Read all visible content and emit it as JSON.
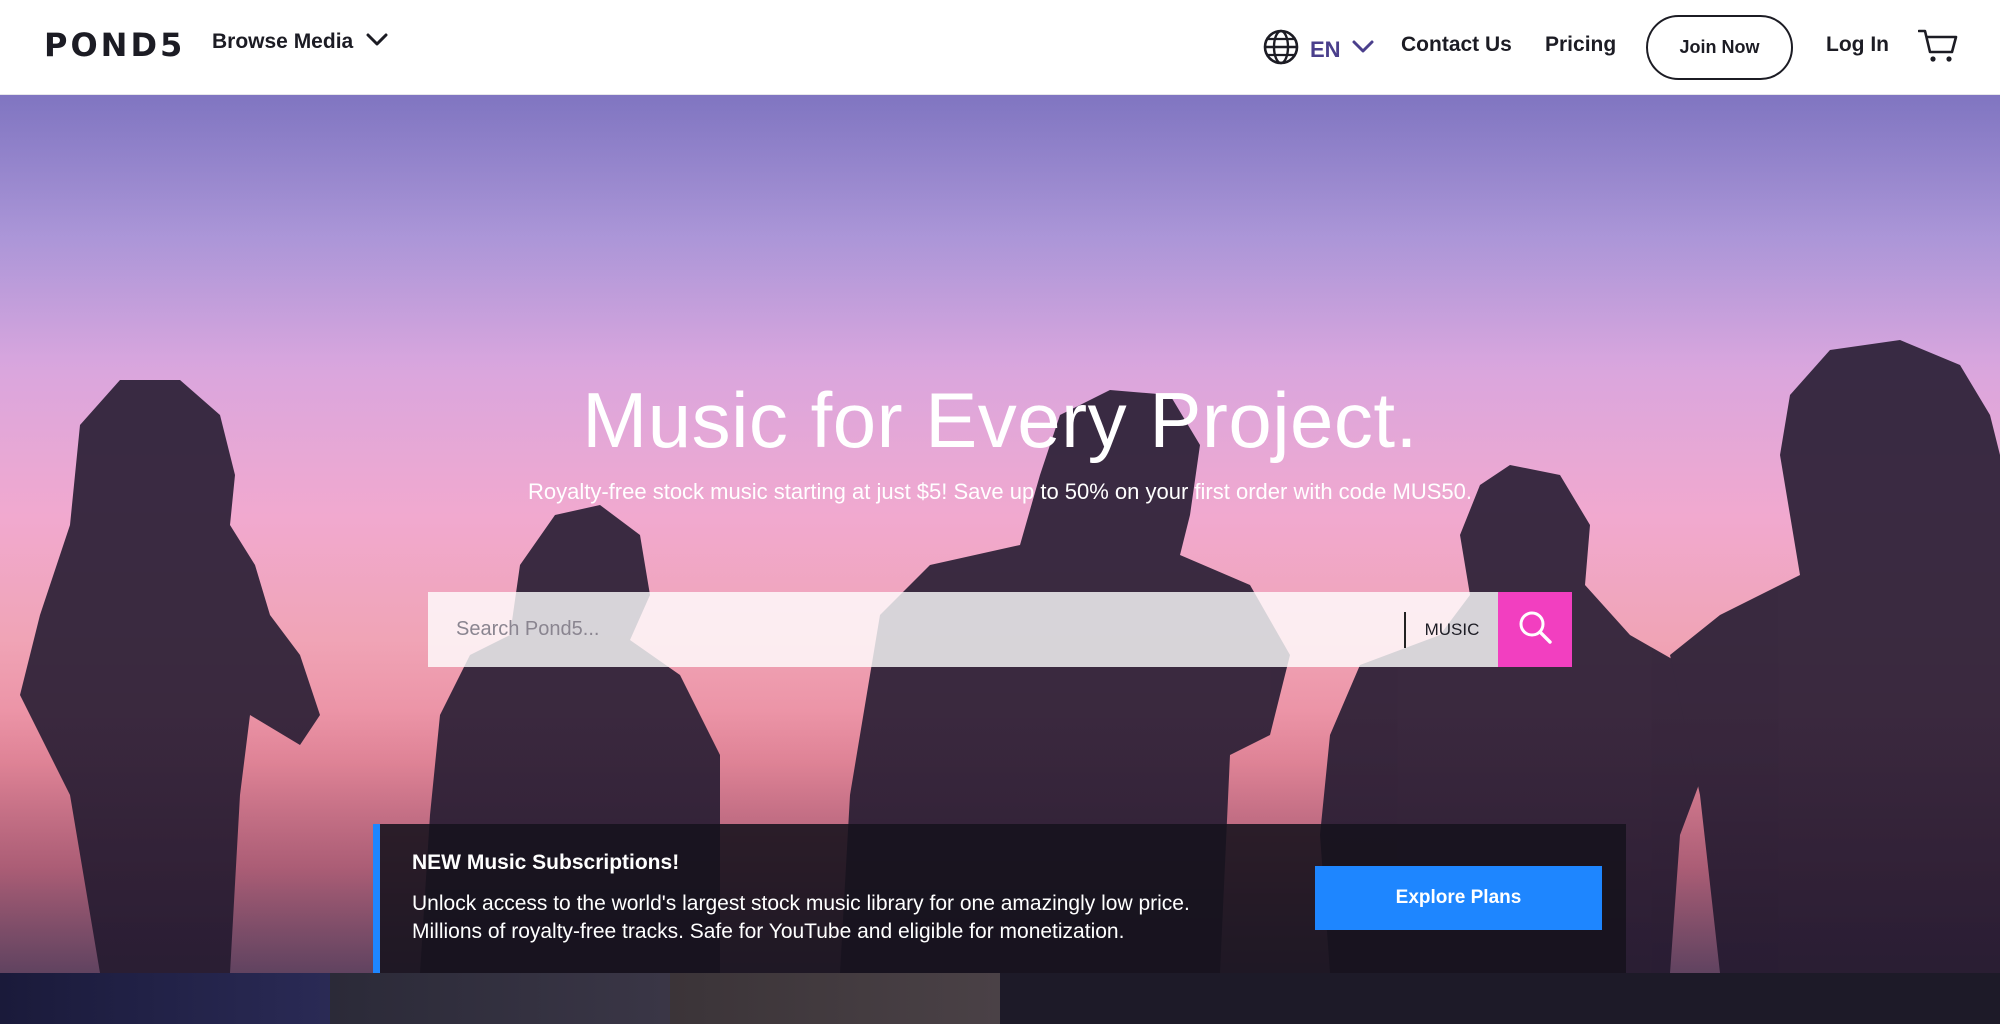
{
  "header": {
    "logo": "POND5",
    "browse_label": "Browse Media",
    "language_code": "EN",
    "contact_label": "Contact Us",
    "pricing_label": "Pricing",
    "join_label": "Join Now",
    "login_label": "Log In",
    "icons": [
      "chevron-down-icon",
      "globe-icon",
      "cart-icon"
    ]
  },
  "hero": {
    "title": "Music for Every Project.",
    "subtitle": "Royalty-free stock music starting at just $5! Save up to 50% on your first order with code MUS50.",
    "search": {
      "placeholder": "Search Pond5...",
      "value": "",
      "category": "MUSIC",
      "button_icon": "search-icon",
      "button_color": "#f23fc0"
    }
  },
  "promo": {
    "title": "NEW Music Subscriptions!",
    "line1": "Unlock access to the world's largest stock music library for one amazingly low price.",
    "line2": "Millions of royalty-free tracks. Safe for YouTube and eligible for monetization.",
    "button_label": "Explore Plans",
    "accent_color": "#1e86ff"
  }
}
